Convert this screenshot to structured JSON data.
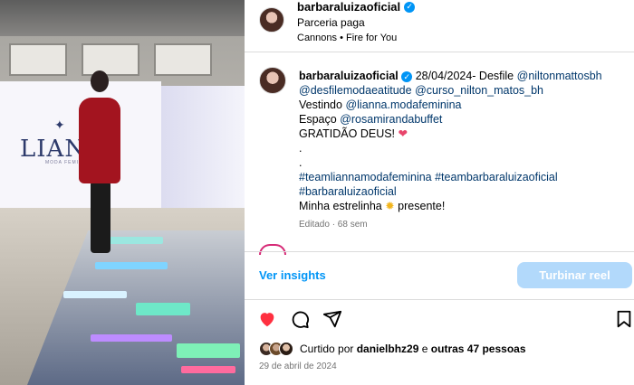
{
  "header": {
    "username": "barbaraluizaoficial",
    "verified_label": "✓",
    "paid_partnership": "Parceria paga",
    "audio": "Cannons • Fire for You",
    "more_icon": "more-horizontal-icon"
  },
  "media": {
    "banner_logo": "LIANN",
    "banner_sub": "MODA FEMININA"
  },
  "caption": {
    "username": "barbaraluizaoficial",
    "date_text": "28/04/2024- Desfile",
    "mention_1": "@niltonmattosbh",
    "mention_2": "@desfilemodaeatitude",
    "mention_3": "@curso_nilton_matos_bh",
    "vestindo_label": "Vestindo",
    "mention_4": "@lianna.modafeminina",
    "espaco_label": "Espaço",
    "mention_5": "@rosamirandabuffet",
    "gratidao": "GRATIDÃO DEUS!",
    "dot_1": ".",
    "dot_2": ".",
    "hashtag_1": "#teamliannamodafeminina",
    "hashtag_2": "#teambarbaraluizaoficial",
    "hashtag_3": "#barbaraluizaoficial",
    "closing_part1": "Minha estrelinha",
    "closing_part2": "presente!",
    "meta": "Editado · 68 sem"
  },
  "insights": {
    "link": "Ver insights",
    "boost": "Turbinar reel"
  },
  "actions": {
    "like_icon": "heart-filled-icon",
    "comment_icon": "comment-icon",
    "share_icon": "share-icon",
    "save_icon": "bookmark-icon",
    "like_color": "#ff3040"
  },
  "likes": {
    "prefix": "Curtido por",
    "user": "danielbhz29",
    "middle": "e",
    "others": "outras 47 pessoas"
  },
  "post_date": "29 de abril de 2024"
}
